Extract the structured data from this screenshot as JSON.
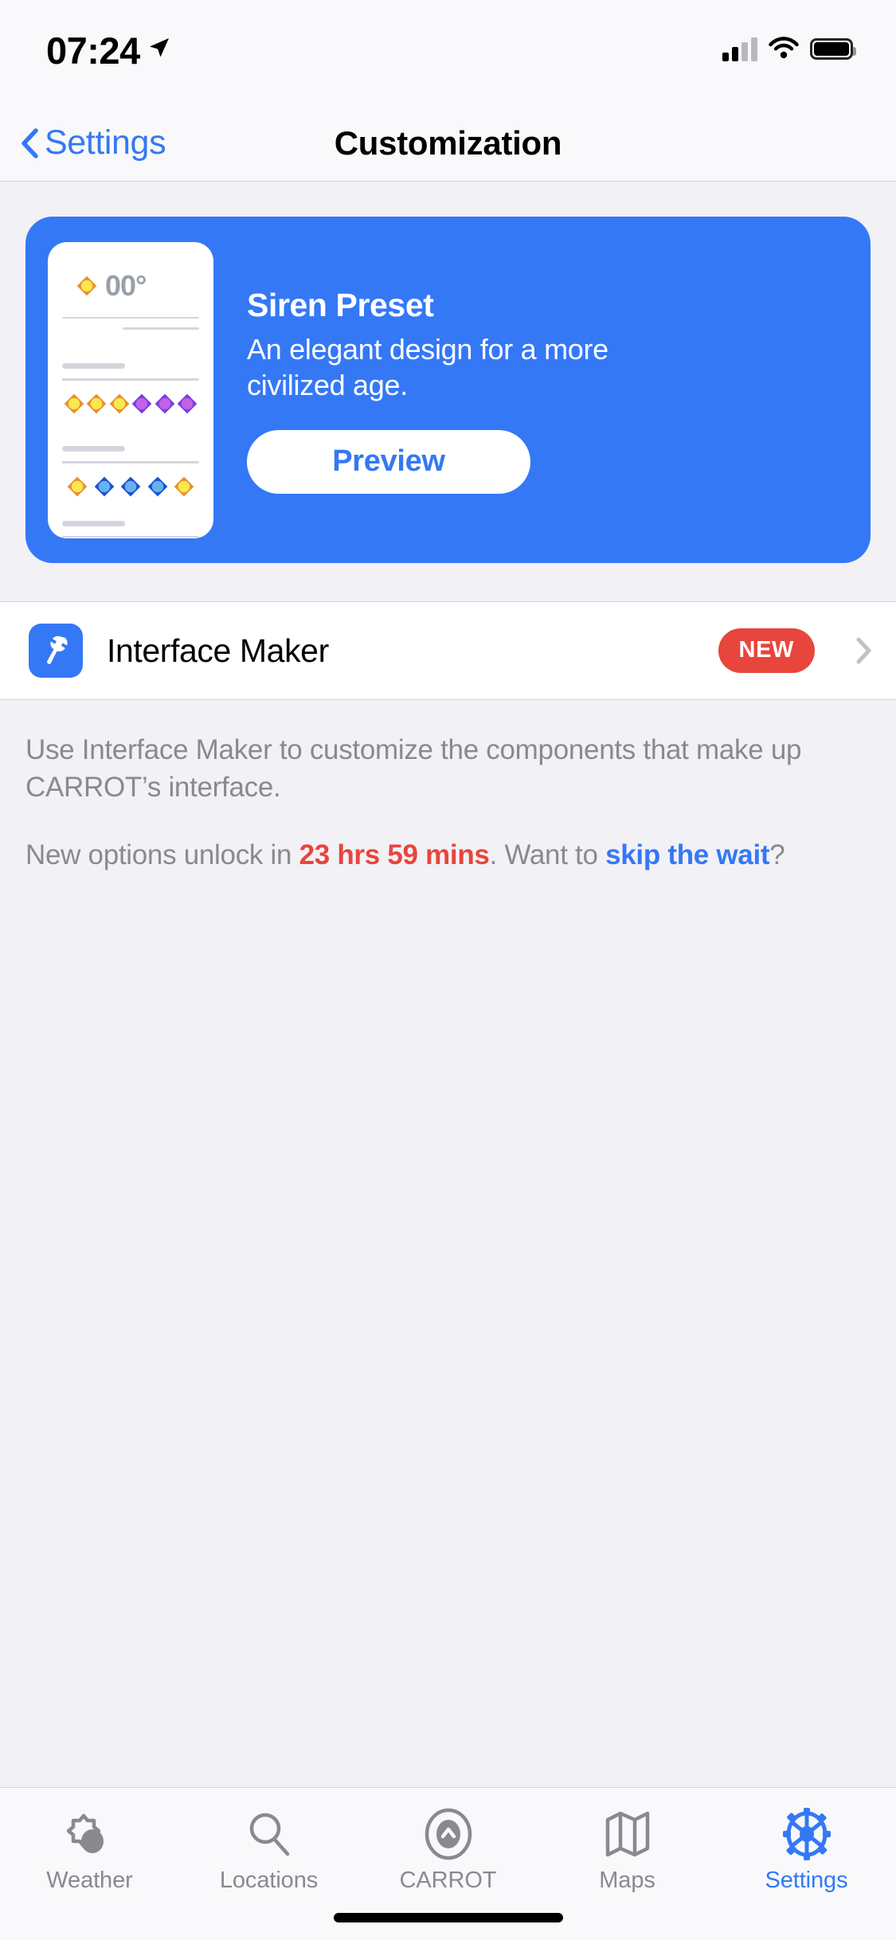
{
  "status_bar": {
    "time": "07:24",
    "location_icon": "location-arrow-icon",
    "cellular_icon": "cellular-bars-icon",
    "wifi_icon": "wifi-icon",
    "battery_icon": "battery-full-icon"
  },
  "nav_bar": {
    "back_label": "Settings",
    "back_icon": "chevron-left-icon",
    "title": "Customization"
  },
  "promo": {
    "title": "Siren Preset",
    "description": "An elegant design for a more civilized age.",
    "button_label": "Preview",
    "card_color": "#3478f6",
    "preview_phone": {
      "temperature": "00°",
      "sun_icon": "sun-diamond-icon",
      "row_one_icons": [
        "sun-diamond-yellow",
        "sun-diamond-yellow",
        "sun-diamond-yellow",
        "diamond-purple",
        "diamond-purple",
        "diamond-purple"
      ],
      "row_two_icons": [
        "sun-diamond-yellow",
        "diamond-blue",
        "diamond-blue",
        "diamond-blue",
        "sun-diamond-yellow"
      ]
    }
  },
  "list": {
    "rows": [
      {
        "label": "Interface Maker",
        "icon": "hammer-icon",
        "icon_bg": "#3478f6",
        "badge": "NEW",
        "badge_color": "#e8453c",
        "chevron": "chevron-right-icon"
      }
    ]
  },
  "footer": {
    "paragraph_one": "Use Interface Maker to customize the components that make up CARROT’s interface.",
    "paragraph_two_prefix": "New options unlock in ",
    "countdown": "23 hrs 59 mins",
    "paragraph_two_middle": ". Want to ",
    "link": "skip the wait",
    "paragraph_two_suffix": "?",
    "countdown_color": "#e8453c",
    "link_color": "#3478f6"
  },
  "tab_bar": {
    "items": [
      {
        "label": "Weather",
        "icon": "cloud-sun-icon",
        "active": false
      },
      {
        "label": "Locations",
        "icon": "search-icon",
        "active": false
      },
      {
        "label": "CARROT",
        "icon": "carrot-eye-icon",
        "active": false
      },
      {
        "label": "Maps",
        "icon": "map-icon",
        "active": false
      },
      {
        "label": "Settings",
        "icon": "gear-icon",
        "active": true
      }
    ],
    "active_color": "#3478f6",
    "inactive_color": "#8a8a8e"
  },
  "home_indicator": "home-indicator"
}
